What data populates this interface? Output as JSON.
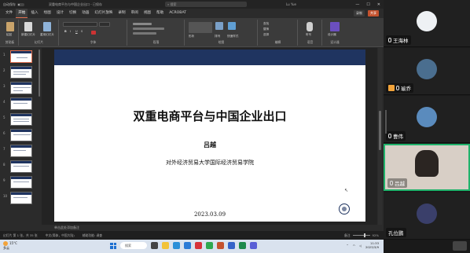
{
  "window": {
    "autosave_label": "自动保存",
    "doc_title": "双重电商平台与中国企业出口 - 已保存",
    "search_placeholder": "搜索",
    "user": "Lu Yue",
    "controls": [
      "—",
      "☐",
      "✕"
    ]
  },
  "menu": {
    "tabs": [
      "文件",
      "开始",
      "插入",
      "绘图",
      "设计",
      "切换",
      "动画",
      "幻灯片放映",
      "录制",
      "审阅",
      "视图",
      "帮助",
      "ACROBAT"
    ],
    "active": "开始",
    "record_label": "录制",
    "share_label": "共享"
  },
  "ribbon": {
    "groups": [
      {
        "name": "剪贴板",
        "buttons": [
          "粘贴"
        ]
      },
      {
        "name": "幻灯片",
        "buttons": [
          "新建幻灯片",
          "重用幻灯片"
        ]
      },
      {
        "name": "字体",
        "buttons": [
          "B",
          "I",
          "U",
          "S"
        ]
      },
      {
        "name": "段落",
        "buttons": []
      },
      {
        "name": "绘图",
        "buttons": [
          "形状",
          "排列",
          "快速样式"
        ]
      },
      {
        "name": "编辑",
        "buttons": [
          "查找",
          "替换",
          "选择"
        ]
      },
      {
        "name": "语音",
        "buttons": [
          "听写"
        ]
      },
      {
        "name": "设计器",
        "buttons": [
          "设计器"
        ]
      }
    ]
  },
  "thumbnails": {
    "numbers": [
      "1",
      "2",
      "3",
      "4",
      "5",
      "6",
      "7",
      "8",
      "9",
      "10"
    ],
    "selected": "1"
  },
  "slide": {
    "title": "双重电商平台与中国企业出口",
    "author": "吕越",
    "affiliation": "对外经济贸易大学国际经济贸易学院",
    "date": "2023.03.09"
  },
  "notes_placeholder": "单击此处添加备注",
  "statusbar": {
    "slide_info": "幻灯片 第 1 张，共 35 张",
    "language": "中文(简体，中国大陆)",
    "accessibility": "辅助功能: 调查",
    "notes_btn": "备注",
    "zoom": "92%"
  },
  "taskbar": {
    "weather_temp": "15°C",
    "weather_desc": "多云",
    "search_label": "搜索",
    "time": "11:33",
    "date": "2023/3/9"
  },
  "participants": [
    {
      "name": "",
      "color": "#e9eef2"
    },
    {
      "name": "王海林",
      "color": "#b9c6d3"
    },
    {
      "name": "瑜乔",
      "color": "#4a6e8f",
      "hand": true
    },
    {
      "name": "曹伟",
      "color": "#5a8bbd"
    },
    {
      "name": "吕越",
      "color": "#d8cfc6",
      "active": true
    },
    {
      "name": "孔位鹏",
      "color": "#3a3f6a"
    }
  ],
  "colors": {
    "accent": "#e26f4f",
    "slide_band": "#1f3460",
    "active_speaker": "#1fb36b"
  }
}
